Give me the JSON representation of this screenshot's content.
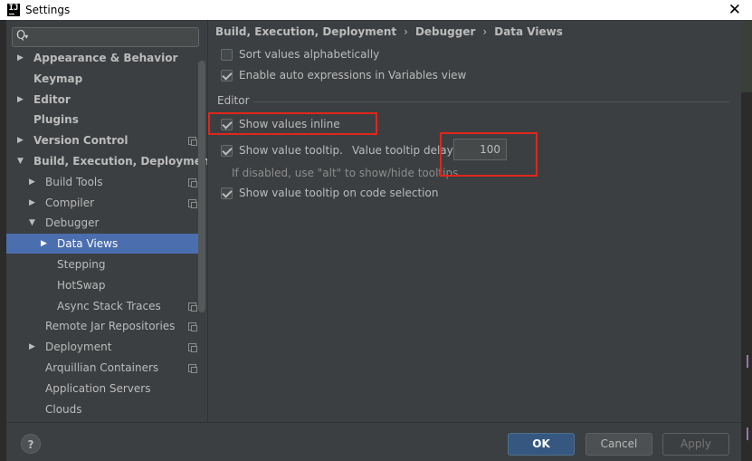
{
  "window": {
    "title": "Settings",
    "app_icon": "intellij-icon",
    "close_glyph": "✕"
  },
  "search": {
    "value": "",
    "placeholder": ""
  },
  "tree": [
    {
      "label": "Appearance & Behavior",
      "bold": true,
      "arrow": "▶",
      "copy": false
    },
    {
      "label": "Keymap",
      "bold": true,
      "arrow": "",
      "copy": false
    },
    {
      "label": "Editor",
      "bold": true,
      "arrow": "▶",
      "copy": false
    },
    {
      "label": "Plugins",
      "bold": true,
      "arrow": "",
      "copy": false
    },
    {
      "label": "Version Control",
      "bold": true,
      "arrow": "▶",
      "copy": true
    },
    {
      "label": "Build, Execution, Deployment",
      "bold": true,
      "arrow": "▼",
      "copy": false
    },
    {
      "label": "Build Tools",
      "bold": false,
      "arrow": "▶",
      "copy": true
    },
    {
      "label": "Compiler",
      "bold": false,
      "arrow": "▶",
      "copy": true
    },
    {
      "label": "Debugger",
      "bold": false,
      "arrow": "▼",
      "copy": false
    },
    {
      "label": "Data Views",
      "bold": false,
      "arrow": "▶",
      "copy": false,
      "selected": true
    },
    {
      "label": "Stepping",
      "bold": false,
      "arrow": "",
      "copy": false
    },
    {
      "label": "HotSwap",
      "bold": false,
      "arrow": "",
      "copy": false
    },
    {
      "label": "Async Stack Traces",
      "bold": false,
      "arrow": "",
      "copy": true
    },
    {
      "label": "Remote Jar Repositories",
      "bold": false,
      "arrow": "",
      "copy": true
    },
    {
      "label": "Deployment",
      "bold": false,
      "arrow": "▶",
      "copy": true
    },
    {
      "label": "Arquillian Containers",
      "bold": false,
      "arrow": "",
      "copy": true
    },
    {
      "label": "Application Servers",
      "bold": false,
      "arrow": "",
      "copy": false
    },
    {
      "label": "Clouds",
      "bold": false,
      "arrow": "",
      "copy": false
    }
  ],
  "breadcrumb": {
    "part1": "Build, Execution, Deployment",
    "part2": "Debugger",
    "part3": "Data Views",
    "sep": "›"
  },
  "options": {
    "sort_alpha": {
      "label": "Sort values alphabetically",
      "checked": false
    },
    "auto_expr": {
      "label": "Enable auto expressions in Variables view",
      "checked": true
    },
    "editor_section": "Editor",
    "show_inline": {
      "label": "Show values inline",
      "checked": true
    },
    "show_tooltip": {
      "label": "Show value tooltip.",
      "checked": true
    },
    "tooltip_delay_label": "Value tooltip delay (ms):",
    "tooltip_delay_value": "100",
    "tooltip_hint": "If disabled, use \"alt\" to show/hide tooltips",
    "tooltip_on_selection": {
      "label": "Show value tooltip on code selection",
      "checked": true
    }
  },
  "buttons": {
    "help": "?",
    "ok": "OK",
    "cancel": "Cancel",
    "apply": "Apply"
  },
  "colors": {
    "selection": "#4b6eaf",
    "highlight_box": "#e0261a",
    "ok_button": "#365880"
  }
}
